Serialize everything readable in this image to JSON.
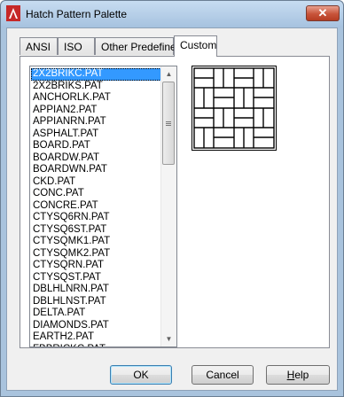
{
  "window": {
    "title": "Hatch Pattern Palette",
    "close_label": "✕"
  },
  "tabs": [
    {
      "label": "ANSI",
      "active": false
    },
    {
      "label": "ISO",
      "active": false
    },
    {
      "label": "Other Predefined",
      "active": false
    },
    {
      "label": "Custom",
      "active": true
    }
  ],
  "patterns": [
    "2X2BRIKC.PAT",
    "2X2BRIKS.PAT",
    "ANCHORLK.PAT",
    "APPIAN2.PAT",
    "APPIANRN.PAT",
    "ASPHALT.PAT",
    "BOARD.PAT",
    "BOARDW.PAT",
    "BOARDWN.PAT",
    "CKD.PAT",
    "CONC.PAT",
    "CONCRE.PAT",
    "CTYSQ6RN.PAT",
    "CTYSQ6ST.PAT",
    "CTYSQMK1.PAT",
    "CTYSQMK2.PAT",
    "CTYSQRN.PAT",
    "CTYSQST.PAT",
    "DBLHLNRN.PAT",
    "DBLHLNST.PAT",
    "DELTA.PAT",
    "DIAMONDS.PAT",
    "EARTH2.PAT",
    "FBBRICKC.PAT"
  ],
  "selected_pattern": "2X2BRIKC.PAT",
  "buttons": {
    "ok": "OK",
    "cancel": "Cancel",
    "help_prefix": "H",
    "help_rest": "elp"
  },
  "icons": {
    "app": "autocad-icon",
    "scroll_up": "scroll-up-arrow-icon",
    "scroll_down": "scroll-down-arrow-icon"
  }
}
